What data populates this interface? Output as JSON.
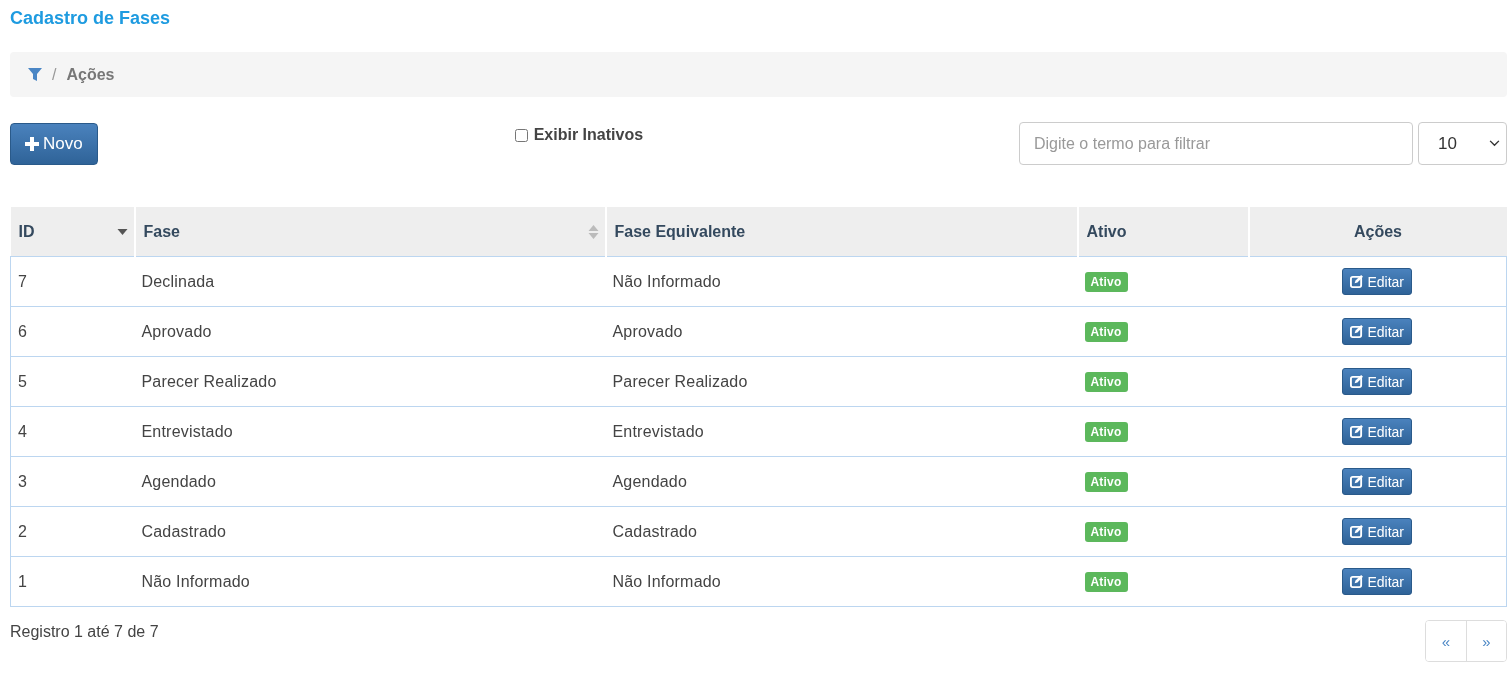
{
  "page_title": "Cadastro de Fases",
  "breadcrumb": {
    "separator": "/",
    "current": "Ações"
  },
  "toolbar": {
    "new_button": "Novo",
    "show_inactive": {
      "label": "Exibir Inativos",
      "checked": false
    },
    "search": {
      "placeholder": "Digite o termo para filtrar"
    },
    "page_size": "10"
  },
  "table": {
    "columns": [
      {
        "label": "ID",
        "sortable": true,
        "sorted": true
      },
      {
        "label": "Fase",
        "sortable": true,
        "sorted": false
      },
      {
        "label": "Fase Equivalente",
        "sortable": false,
        "sorted": false
      },
      {
        "label": "Ativo",
        "sortable": false,
        "sorted": false
      },
      {
        "label": "Ações",
        "sortable": false,
        "sorted": false
      }
    ],
    "rows": [
      {
        "id": "7",
        "phase": "Declinada",
        "equivalent": "Não Informado",
        "status": "Ativo",
        "active": true,
        "action": "Editar"
      },
      {
        "id": "6",
        "phase": "Aprovado",
        "equivalent": "Aprovado",
        "status": "Ativo",
        "active": true,
        "action": "Editar"
      },
      {
        "id": "5",
        "phase": "Parecer Realizado",
        "equivalent": "Parecer Realizado",
        "status": "Ativo",
        "active": true,
        "action": "Editar"
      },
      {
        "id": "4",
        "phase": "Entrevistado",
        "equivalent": "Entrevistado",
        "status": "Ativo",
        "active": true,
        "action": "Editar"
      },
      {
        "id": "3",
        "phase": "Agendado",
        "equivalent": "Agendado",
        "status": "Ativo",
        "active": true,
        "action": "Editar"
      },
      {
        "id": "2",
        "phase": "Cadastrado",
        "equivalent": "Cadastrado",
        "status": "Ativo",
        "active": true,
        "action": "Editar"
      },
      {
        "id": "1",
        "phase": "Não Informado",
        "equivalent": "Não Informado",
        "status": "Ativo",
        "active": true,
        "action": "Editar"
      }
    ]
  },
  "footer": {
    "summary": "Registro 1 até 7 de 7",
    "pagination": [
      "«",
      "»"
    ]
  }
}
